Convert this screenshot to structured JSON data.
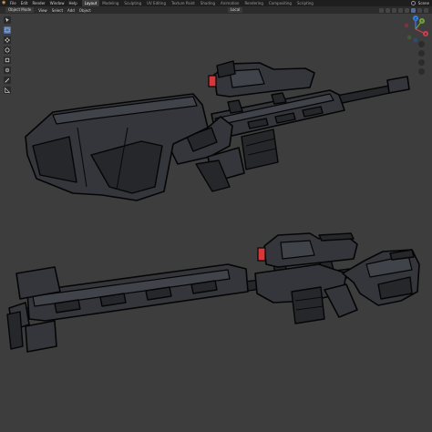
{
  "topbar": {
    "menus": [
      "File",
      "Edit",
      "Render",
      "Window",
      "Help"
    ],
    "workspaces": [
      "Layout",
      "Modeling",
      "Sculpting",
      "UV Editing",
      "Texture Paint",
      "Shading",
      "Animation",
      "Rendering",
      "Compositing",
      "Scripting"
    ],
    "active_workspace": "Layout",
    "scene": "Scene"
  },
  "header": {
    "mode": "Object Mode",
    "menus": [
      "View",
      "Select",
      "Add",
      "Object"
    ],
    "orientation": "Local"
  },
  "gizmo": {
    "x_label": "X",
    "y_label": "Y",
    "z_label": "Z"
  },
  "icons": {
    "tools": [
      "cursor-tool-icon",
      "select-box-icon",
      "move-tool-icon",
      "rotate-tool-icon",
      "scale-tool-icon",
      "transform-tool-icon",
      "annotate-tool-icon",
      "measure-tool-icon"
    ],
    "nav": [
      "zoom-icon",
      "pan-icon",
      "camera-view-icon",
      "perspective-toggle-icon"
    ]
  },
  "colors": {
    "viewport_bg": "#3d3d3d",
    "model_fill": "#34363b",
    "model_dark": "#25272b",
    "outline": "#050505",
    "scope_lens": "#d8373a",
    "accent_blue": "#4b6ea8"
  }
}
